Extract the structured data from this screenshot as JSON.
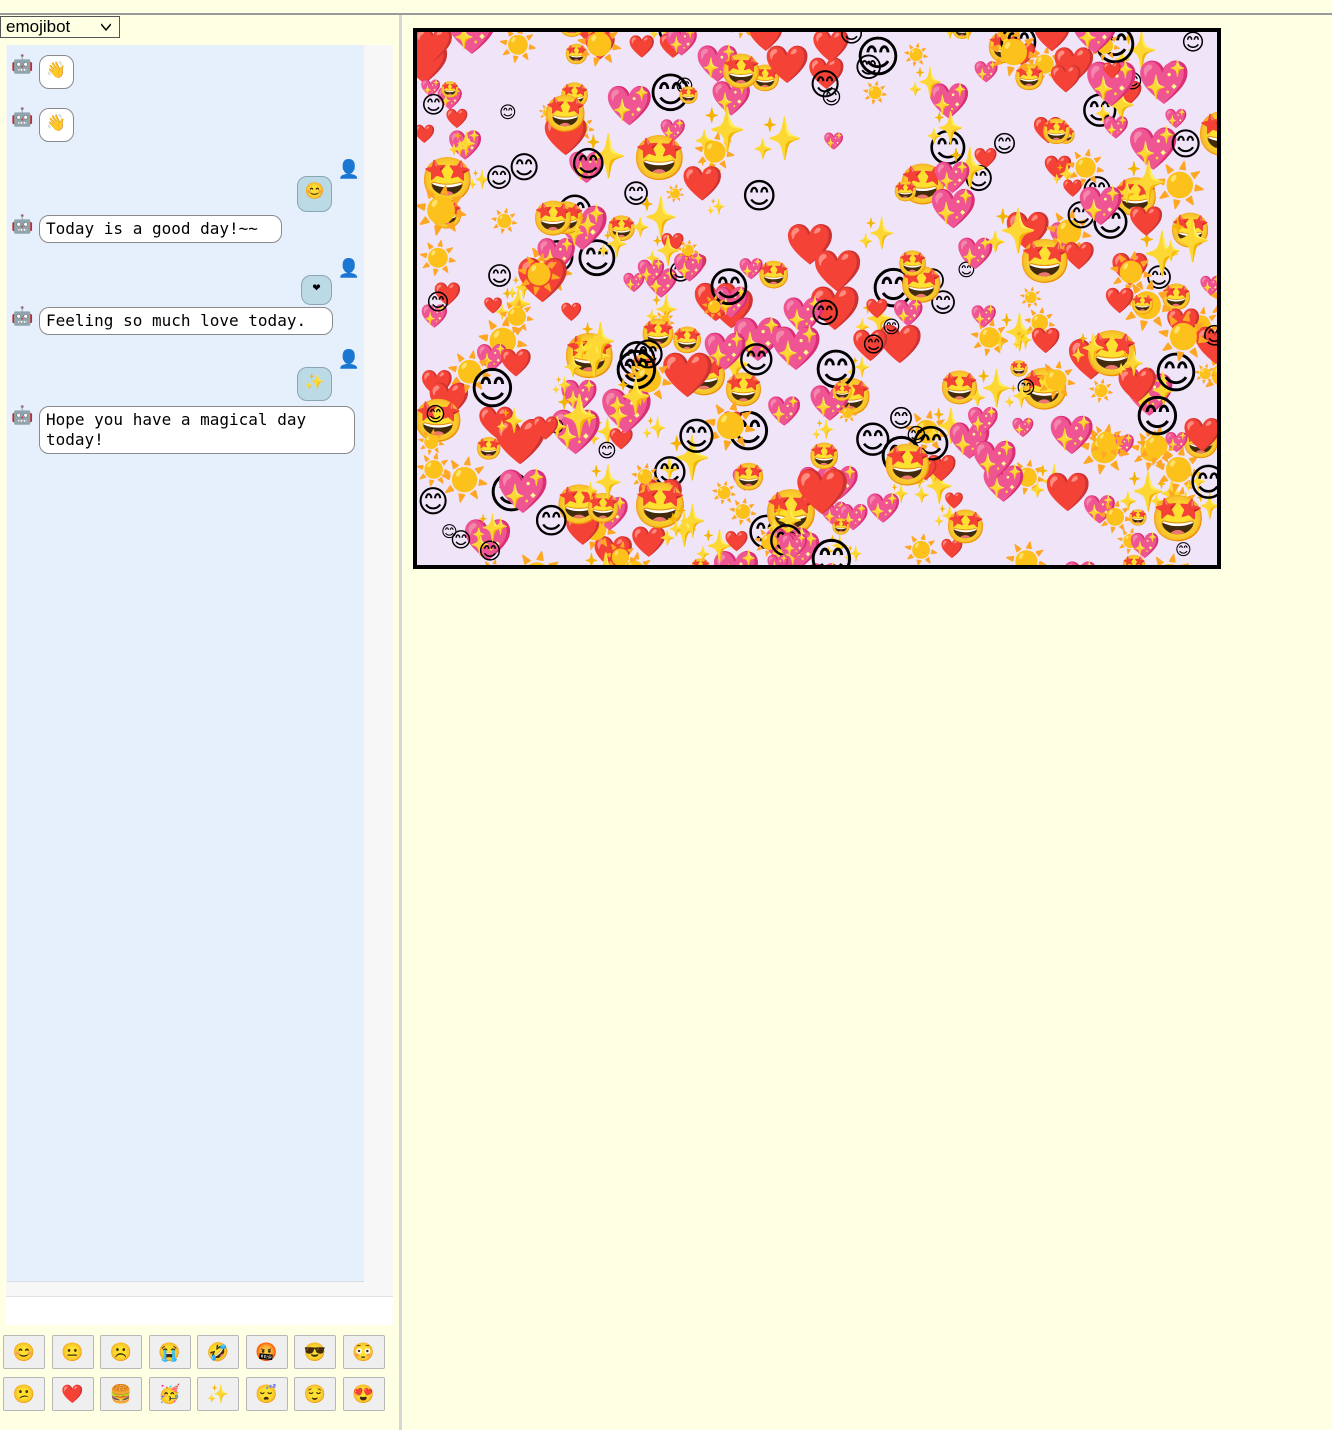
{
  "bot_select": {
    "value": "emojibot"
  },
  "avatars": {
    "bot": "🤖",
    "user": "👤"
  },
  "messages": [
    {
      "sender": "bot",
      "text": "👋"
    },
    {
      "sender": "bot",
      "text": "👋"
    },
    {
      "sender": "user",
      "text": "😊"
    },
    {
      "sender": "bot",
      "text": "Today is a good day!~~"
    },
    {
      "sender": "user",
      "text": "❤"
    },
    {
      "sender": "bot",
      "text": "Feeling so much love today."
    },
    {
      "sender": "user",
      "text": "✨"
    },
    {
      "sender": "bot",
      "text": "Hope you have a magical day today!"
    }
  ],
  "emoji_buttons": [
    [
      "😊",
      "😐",
      "☹️",
      "😭",
      "🤣",
      "🤬",
      "😎",
      "😳"
    ],
    [
      "😕",
      "❤️",
      "🍔",
      "🥳",
      "✨",
      "😴",
      "😌",
      "😍"
    ]
  ],
  "stage": {
    "background": "#f0e4f9",
    "emojis": [
      "😊",
      "❤️",
      "💖",
      "☀️",
      "🤩",
      "✨"
    ]
  },
  "colors": {
    "page_background": "#ffffe3",
    "chat_background": "#e6f0fd",
    "user_bubble": "#bcd9e6",
    "bot_bubble": "#ffffff"
  }
}
